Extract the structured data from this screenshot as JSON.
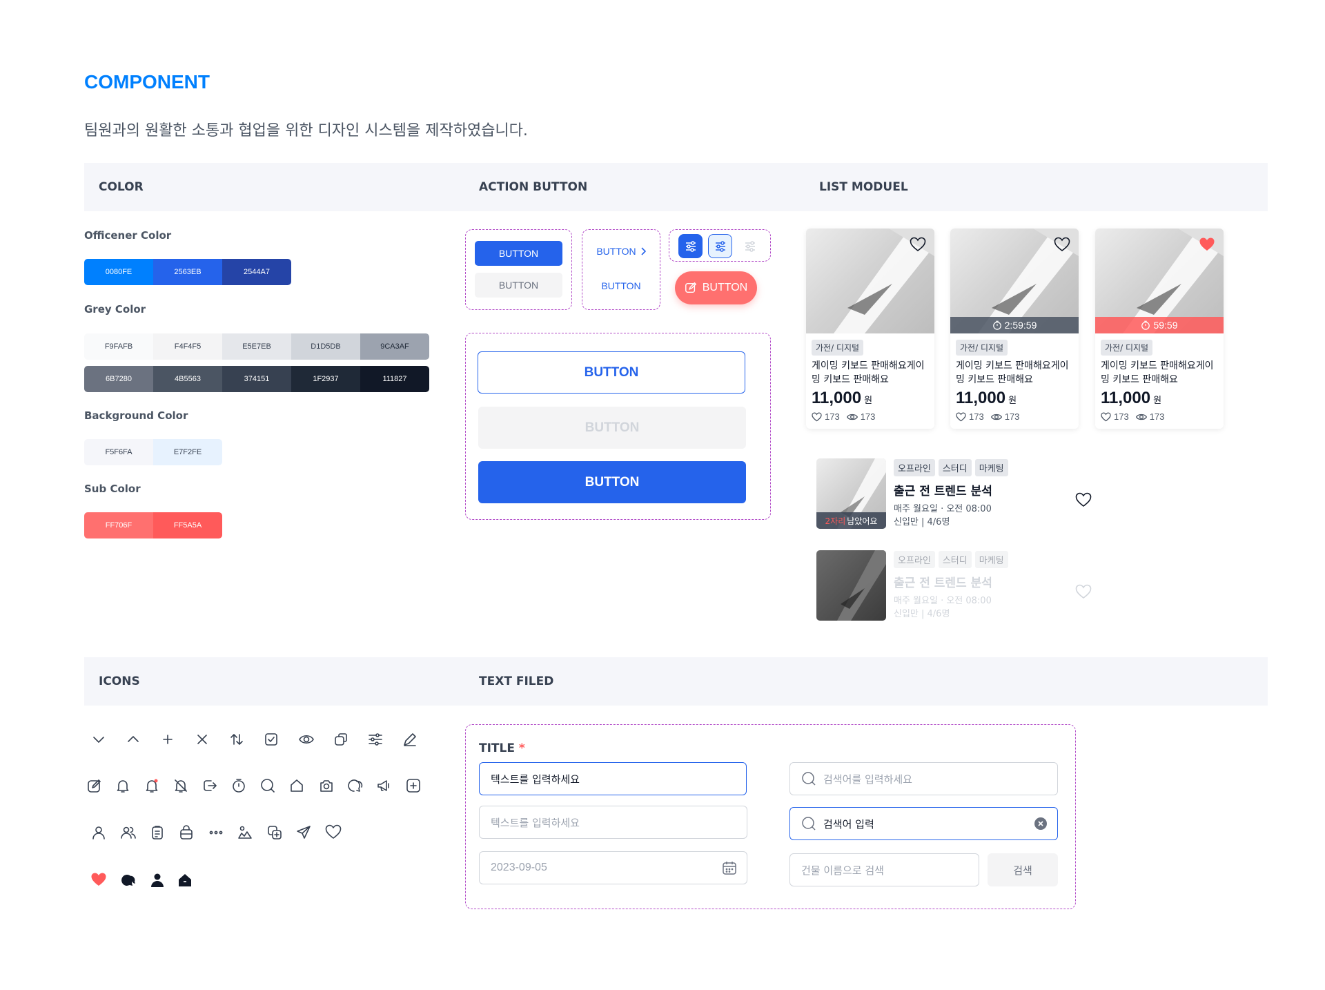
{
  "page": {
    "title": "COMPONENT",
    "subtitle": "팀원과의 원활한 소통과 협업을 위한 디자인 시스템을 제작하였습니다."
  },
  "sections": {
    "color": "COLOR",
    "action_button": "ACTION BUTTON",
    "list_module": "LIST MODUEL",
    "icons": "ICONS",
    "text_field": "TEXT FILED"
  },
  "colors": {
    "officener_label": "Officener Color",
    "officener": [
      "0080FE",
      "2563EB",
      "2544A7"
    ],
    "grey_label": "Grey Color",
    "grey_light": [
      "F9FAFB",
      "F4F4F5",
      "E5E7EB",
      "D1D5DB",
      "9CA3AF"
    ],
    "grey_dark": [
      "6B7280",
      "4B5563",
      "374151",
      "1F2937",
      "111827"
    ],
    "background_label": "Background Color",
    "background": [
      "F5F6FA",
      "E7F2FE"
    ],
    "sub_label": "Sub Color",
    "sub": [
      "FF706F",
      "FF5A5A"
    ]
  },
  "buttons": {
    "small_primary": "BUTTON",
    "small_grey": "BUTTON",
    "text_arrow": "BUTTON",
    "text_plain": "BUTTON",
    "fab": "BUTTON",
    "outline_large": "BUTTON",
    "disabled_large": "BUTTON",
    "primary_large": "BUTTON"
  },
  "products": [
    {
      "category": "가전/ 디지털",
      "title": "게이밍 키보드 판매해요게이밍 키보드 판매해요",
      "price": "11,000",
      "unit": "원",
      "likes": "173",
      "views": "173",
      "timer": "",
      "liked": false
    },
    {
      "category": "가전/ 디지털",
      "title": "게이밍 키보드 판매해요게이밍 키보드 판매해요",
      "price": "11,000",
      "unit": "원",
      "likes": "173",
      "views": "173",
      "timer": "2:59:59",
      "liked": false
    },
    {
      "category": "가전/ 디지털",
      "title": "게이밍 키보드 판매해요게이밍 키보드 판매해요",
      "price": "11,000",
      "unit": "원",
      "likes": "173",
      "views": "173",
      "timer": "59:59",
      "liked": true
    }
  ],
  "studies": [
    {
      "tags": [
        "오프라인",
        "스터디",
        "마케팅"
      ],
      "title": "출근 전 트렌드 분석",
      "schedule": "매주 월요일 · 오전 08:00",
      "meta": "신입만 | 4/6명",
      "remain_count": "2자리",
      "remain_text": "남았어요"
    },
    {
      "tags": [
        "오프라인",
        "스터디",
        "마케팅"
      ],
      "title": "출근 전 트렌드 분석",
      "schedule": "매주 월요일 · 오전 08:00",
      "meta": "신입만 | 4/6명"
    }
  ],
  "textfield": {
    "title": "TITLE",
    "required": "*",
    "input_active": "텍스트를 입력하세요",
    "input_placeholder": "텍스트를 입력하세요",
    "date_value": "2023-09-05",
    "search_placeholder": "검색어를 입력하세요",
    "search_value": "검색어 입력",
    "building_placeholder": "건물 이름으로 검색",
    "search_button": "검색"
  },
  "icon_names": {
    "row1": [
      "chevron-down-icon",
      "chevron-up-icon",
      "plus-icon",
      "close-icon",
      "sort-icon",
      "checkbox-icon",
      "eye-icon",
      "copy-icon",
      "filter-icon",
      "pencil-icon"
    ],
    "row2": [
      "edit-icon",
      "bell-icon",
      "bell-dot-icon",
      "bell-off-icon",
      "exit-icon",
      "timer-icon",
      "search-icon",
      "home-icon",
      "camera-icon",
      "chat-icon",
      "megaphone-icon",
      "plus-square-icon"
    ],
    "row3": [
      "user-icon",
      "users-icon",
      "clipboard-icon",
      "bag-icon",
      "more-icon",
      "image-icon",
      "copy-plus-icon",
      "send-icon",
      "heart-icon"
    ],
    "row4": [
      "heart-filled-icon",
      "chat-filled-icon",
      "user-filled-icon",
      "home-filled-icon"
    ]
  },
  "palette": {
    "primary": "#2563EB",
    "accent": "#0080FE",
    "sub": "#FF706F",
    "fab": "#FF706F"
  }
}
